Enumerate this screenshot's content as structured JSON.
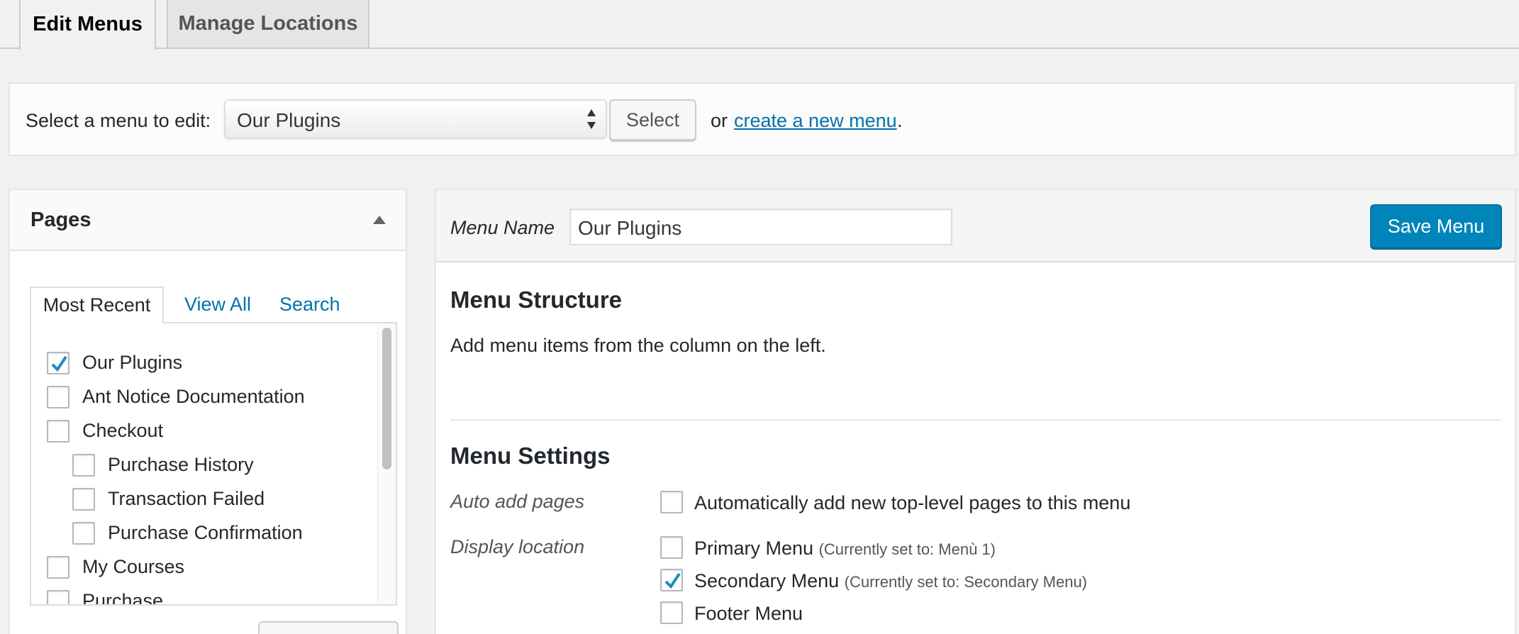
{
  "tabs": {
    "edit_menus": "Edit Menus",
    "manage_locations": "Manage Locations"
  },
  "select_bar": {
    "label": "Select a menu to edit:",
    "selected_menu": "Our Plugins",
    "select_button": "Select",
    "or_text": "or",
    "create_link": "create a new menu",
    "period": "."
  },
  "pages_panel": {
    "title": "Pages",
    "tabs": [
      "Most Recent",
      "View All",
      "Search"
    ],
    "items": [
      {
        "label": "Our Plugins",
        "checked": true,
        "indent": 0
      },
      {
        "label": "Ant Notice Documentation",
        "checked": false,
        "indent": 0
      },
      {
        "label": "Checkout",
        "checked": false,
        "indent": 0
      },
      {
        "label": "Purchase History",
        "checked": false,
        "indent": 1
      },
      {
        "label": "Transaction Failed",
        "checked": false,
        "indent": 1
      },
      {
        "label": "Purchase Confirmation",
        "checked": false,
        "indent": 1
      },
      {
        "label": "My Courses",
        "checked": false,
        "indent": 0
      },
      {
        "label": "Purchase",
        "checked": false,
        "indent": 0
      }
    ]
  },
  "menu_editor": {
    "name_label": "Menu Name",
    "name_value": "Our Plugins",
    "save_button": "Save Menu",
    "structure_heading": "Menu Structure",
    "structure_text": "Add menu items from the column on the left.",
    "settings_heading": "Menu Settings",
    "auto_add_label": "Auto add pages",
    "auto_add_option": "Automatically add new top-level pages to this menu",
    "auto_add_checked": false,
    "display_location_label": "Display location",
    "locations": [
      {
        "name": "Primary Menu",
        "note": "(Currently set to: Menù 1)",
        "checked": false
      },
      {
        "name": "Secondary Menu",
        "note": "(Currently set to: Secondary Menu)",
        "checked": true
      },
      {
        "name": "Footer Menu",
        "note": "",
        "checked": false
      }
    ]
  },
  "colors": {
    "accent": "#0073aa",
    "button_primary": "#0085ba",
    "checkmark": "#1e8cbe"
  }
}
